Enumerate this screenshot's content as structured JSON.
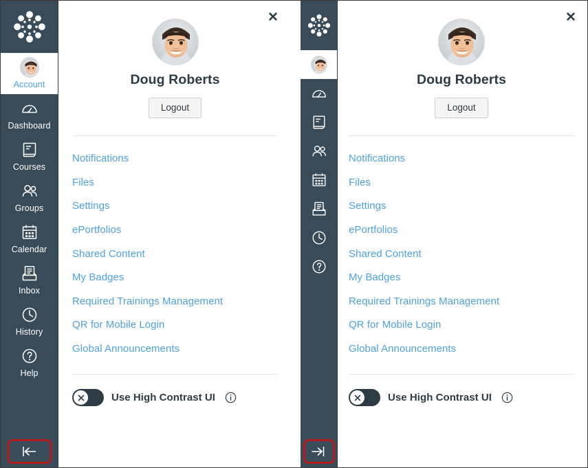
{
  "panels": [
    {
      "id": "expanded",
      "sidebar_state": "expanded",
      "toggle_button_label": "Collapse navigation",
      "toggle_icon": "arrow-left-to-bar-icon"
    },
    {
      "id": "collapsed",
      "sidebar_state": "collapsed",
      "toggle_button_label": "Expand navigation",
      "toggle_icon": "arrow-right-to-bar-icon"
    }
  ],
  "nav": {
    "logo_label": "Canvas",
    "logo_icon": "canvas-logo-icon",
    "items": [
      {
        "label": "Account",
        "icon": "user-avatar-icon",
        "active": true
      },
      {
        "label": "Dashboard",
        "icon": "speedometer-icon",
        "active": false
      },
      {
        "label": "Courses",
        "icon": "book-icon",
        "active": false
      },
      {
        "label": "Groups",
        "icon": "people-icon",
        "active": false
      },
      {
        "label": "Calendar",
        "icon": "calendar-icon",
        "active": false
      },
      {
        "label": "Inbox",
        "icon": "inbox-tray-icon",
        "active": false
      },
      {
        "label": "History",
        "icon": "clock-icon",
        "active": false
      },
      {
        "label": "Help",
        "icon": "question-circle-icon",
        "active": false
      }
    ]
  },
  "tray": {
    "close_label": "✕",
    "close_icon": "close-icon",
    "user_name": "Doug Roberts",
    "avatar_icon": "user-photo-avatar",
    "logout_label": "Logout",
    "links": [
      "Notifications",
      "Files",
      "Settings",
      "ePortfolios",
      "Shared Content",
      "My Badges",
      "Required Trainings Management",
      "QR for Mobile Login",
      "Global Announcements"
    ],
    "high_contrast": {
      "label": "Use High Contrast UI",
      "state": "off",
      "knob_glyph": "✕",
      "info_icon": "info-circle-icon"
    }
  },
  "colors": {
    "nav_background": "#394B58",
    "link_blue": "#4FA2E0",
    "text_dark": "#2D3B45",
    "highlight_red": "#B01A1A",
    "divider": "#E3E5E7"
  }
}
